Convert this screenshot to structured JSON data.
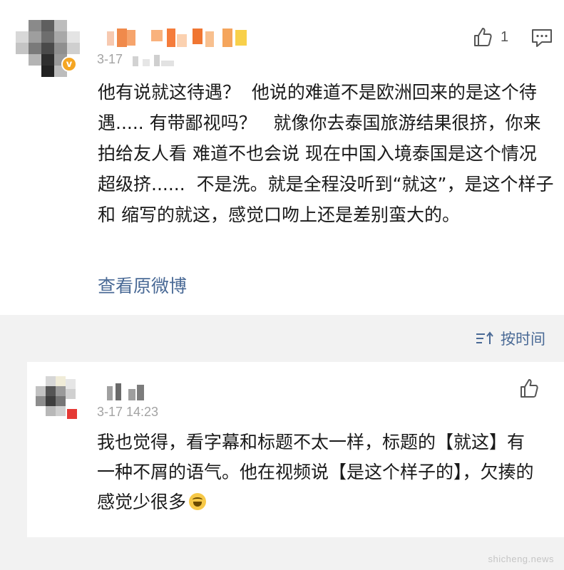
{
  "comment": {
    "date_visible": "3-17",
    "like_count": "1",
    "body": "他有说就这待遇？  他说的难道不是欧洲回来的是这个待遇..... 有带鄙视吗？   就像你去泰国旅游结果很挤，你来拍给友人看 难道不也会说 现在中国入境泰国是这个情况 超级挤......  不是洗。就是全程没听到“就这”，是这个样子 和 缩写的就这，感觉口吻上还是差别蛮大的。",
    "view_original_label": "查看原微博"
  },
  "sort": {
    "label": "按时间"
  },
  "reply": {
    "time": "3-17 14:23",
    "body": "我也觉得，看字幕和标题不太一样，标题的【就这】有一种不屑的语气。他在视频说【是这个样子的】，欠揍的感觉少很多"
  },
  "watermark": "shicheng.news",
  "colors": {
    "link_blue": "#4a6a96",
    "meta_gray": "#a3a3a3",
    "separator_gray": "#f2f2f2",
    "verified_orange": "#f5a623"
  },
  "icons": {
    "like": "thumbs-up-icon",
    "reply": "comment-bubble-icon",
    "sort": "sort-icon",
    "emoji": "laughing-tears-emoji"
  }
}
